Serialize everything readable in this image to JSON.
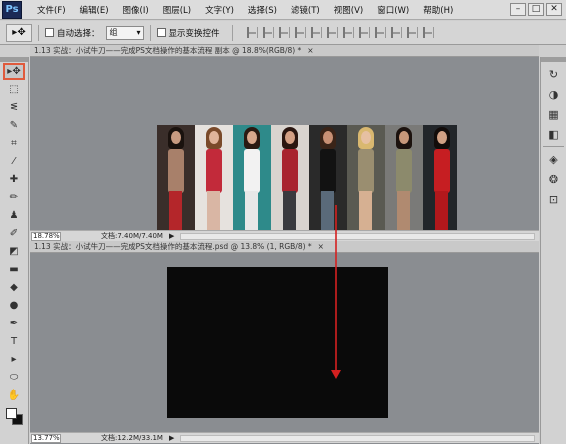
{
  "app": {
    "logo": "Ps"
  },
  "menu": [
    "文件(F)",
    "编辑(E)",
    "图像(I)",
    "图层(L)",
    "文字(Y)",
    "选择(S)",
    "滤镜(T)",
    "视图(V)",
    "窗口(W)",
    "帮助(H)"
  ],
  "window_buttons": {
    "minimize": "–",
    "restore": "□",
    "close": "✕"
  },
  "options": {
    "tool_icon": "▸✥",
    "auto_select_label": "自动选择：",
    "auto_select_value": "组",
    "transform_label": "显示变换控件"
  },
  "doc1": {
    "tab_title": "1.13 实战：小试牛刀——完成PS文档操作的基本流程 副本 @ 18.8%(RGB/8) *",
    "close": "×",
    "zoom": "18.78%",
    "doc_size": "文档:7.40M/7.40M"
  },
  "doc2": {
    "tab_title": "1.13 实战：小试牛刀——完成PS文档操作的基本流程.psd @ 13.8% (1, RGB/8) *",
    "close": "×",
    "zoom": "13.77%",
    "doc_size": "文档:12.2M/33.1M"
  },
  "status_arrow": "▶",
  "tools": [
    {
      "name": "move-tool-icon",
      "glyph": "▸✥",
      "active": true
    },
    {
      "name": "marquee-tool-icon",
      "glyph": "⬚"
    },
    {
      "name": "lasso-tool-icon",
      "glyph": "ᓬ"
    },
    {
      "name": "quick-select-tool-icon",
      "glyph": "✎"
    },
    {
      "name": "crop-tool-icon",
      "glyph": "⌗"
    },
    {
      "name": "eyedropper-tool-icon",
      "glyph": "⁄"
    },
    {
      "name": "healing-tool-icon",
      "glyph": "✚"
    },
    {
      "name": "brush-tool-icon",
      "glyph": "✏"
    },
    {
      "name": "stamp-tool-icon",
      "glyph": "♟"
    },
    {
      "name": "history-brush-tool-icon",
      "glyph": "✐"
    },
    {
      "name": "eraser-tool-icon",
      "glyph": "◩"
    },
    {
      "name": "gradient-tool-icon",
      "glyph": "▬"
    },
    {
      "name": "blur-tool-icon",
      "glyph": "◆"
    },
    {
      "name": "dodge-tool-icon",
      "glyph": "●"
    },
    {
      "name": "pen-tool-icon",
      "glyph": "✒"
    },
    {
      "name": "type-tool-icon",
      "glyph": "T"
    },
    {
      "name": "path-select-tool-icon",
      "glyph": "▸"
    },
    {
      "name": "shape-tool-icon",
      "glyph": "⬭"
    },
    {
      "name": "hand-tool-icon",
      "glyph": "✋"
    },
    {
      "name": "zoom-tool-icon",
      "glyph": "⌕"
    }
  ],
  "dock": [
    {
      "name": "history-panel-icon",
      "glyph": "↻"
    },
    {
      "name": "color-panel-icon",
      "glyph": "◑"
    },
    {
      "name": "swatches-panel-icon",
      "glyph": "▦"
    },
    {
      "name": "styles-panel-icon",
      "glyph": "◧"
    },
    {
      "name": "layers-panel-icon",
      "glyph": "◈"
    },
    {
      "name": "channels-panel-icon",
      "glyph": "❂"
    },
    {
      "name": "paths-panel-icon",
      "glyph": "⊡"
    }
  ],
  "colors": {
    "foreground": "#ffffff",
    "background": "#111111",
    "highlight": "#e05a3c",
    "arrow": "#d42020"
  }
}
